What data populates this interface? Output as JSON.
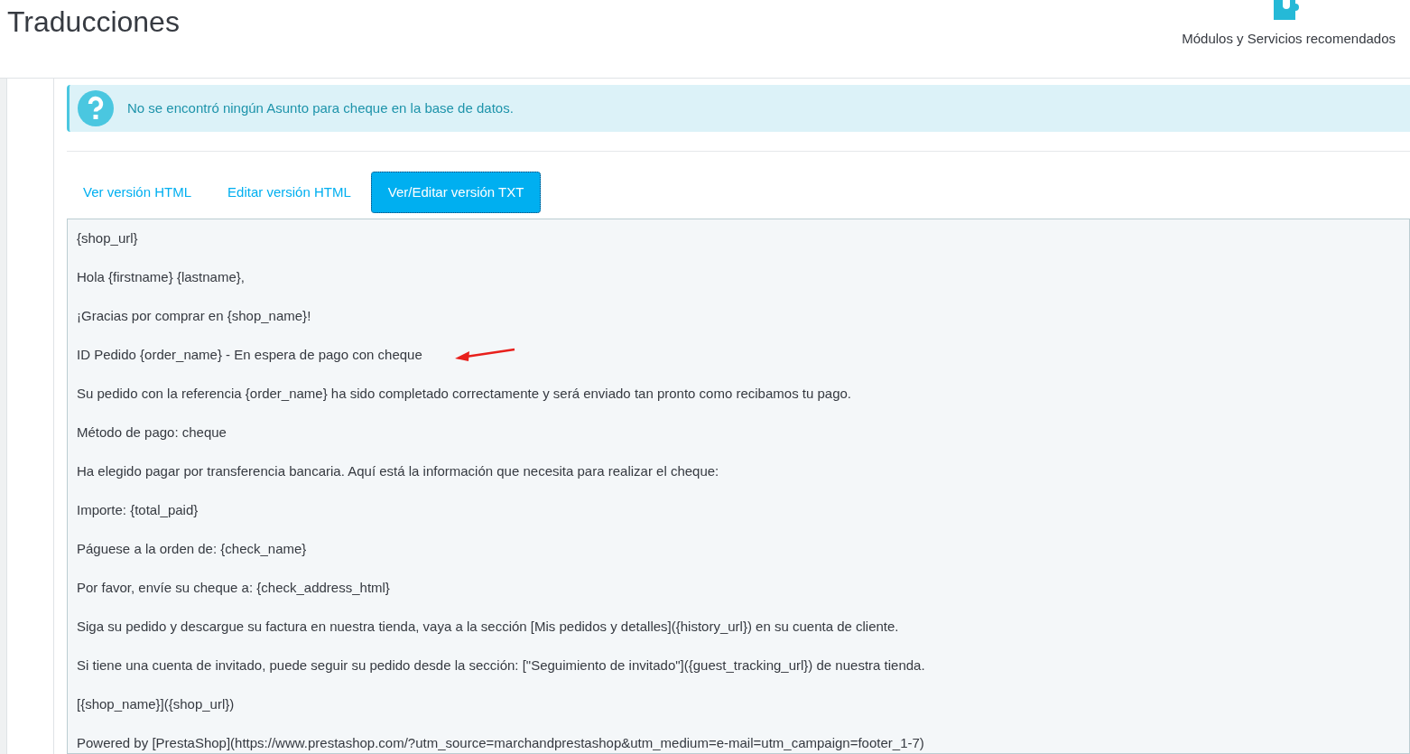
{
  "header": {
    "title": "Traducciones",
    "toolbar_button": "Módulos y Servicios recomendados"
  },
  "alert": {
    "text": "No se encontró ningún Asunto para cheque en la base de datos."
  },
  "tabs": [
    {
      "label": "Ver versión HTML",
      "selected": false
    },
    {
      "label": "Editar versión HTML",
      "selected": false
    },
    {
      "label": "Ver/Editar versión TXT",
      "selected": true
    }
  ],
  "editor": {
    "lines": [
      "{shop_url}",
      "Hola {firstname} {lastname},",
      "¡Gracias por comprar en {shop_name}!",
      "ID Pedido {order_name} - En espera de pago con cheque",
      "Su pedido con la referencia {order_name} ha sido completado correctamente y será enviado tan pronto como recibamos tu pago.",
      "Método de pago: cheque",
      "Ha elegido pagar por transferencia bancaria. Aquí está la información que necesita para realizar el cheque:",
      "Importe:  {total_paid}",
      "Páguese a la orden de:  {check_name}",
      "Por favor, envíe su cheque a:  {check_address_html}",
      "Siga su pedido y descargue su factura en nuestra tienda, vaya a la sección [Mis pedidos y detalles]({history_url}) en su cuenta de cliente.",
      "Si tiene una cuenta de invitado, puede seguir su pedido desde la sección: [\"Seguimiento de invitado\"]({guest_tracking_url}) de nuestra tienda.",
      "[{shop_name}]({shop_url})",
      "Powered by [PrestaShop](https://www.prestashop.com/?utm_source=marchandprestashop&utm_medium=e-mail=utm_campaign=footer_1-7)"
    ]
  }
}
